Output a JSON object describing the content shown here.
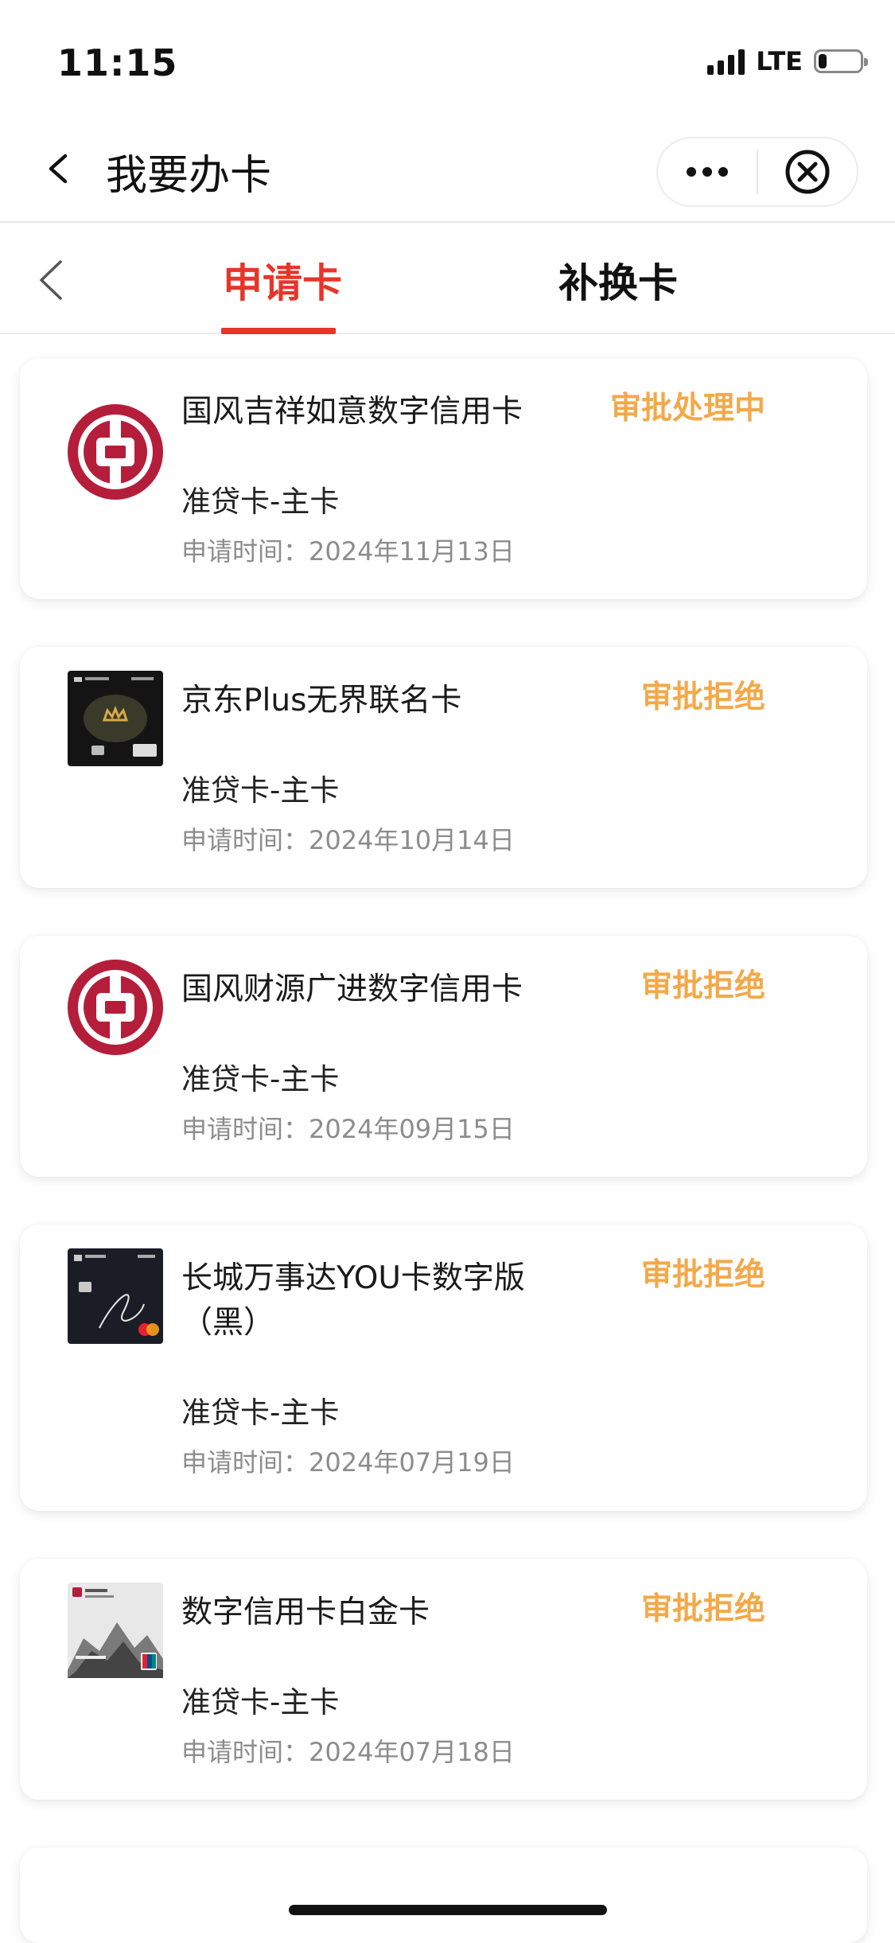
{
  "status_bar": {
    "time": "11:15",
    "network": "LTE",
    "battery_level": 0.2
  },
  "header": {
    "title": "我要办卡",
    "back_icon": "chevron-left-icon",
    "more_icon": "more-dots-icon",
    "close_icon": "close-circle-icon"
  },
  "tabs": {
    "items": [
      {
        "label": "申请卡",
        "active": true
      },
      {
        "label": "补换卡",
        "active": false
      }
    ],
    "accent_color": "#e6352a"
  },
  "applications": [
    {
      "card_name": "国风吉祥如意数字信用卡",
      "status": "审批处理中",
      "card_type": "准贷卡-主卡",
      "apply_time": "申请时间：2024年11月13日",
      "icon": "bank-of-china-logo"
    },
    {
      "card_name": "京东Plus无界联名卡",
      "status": "审批拒绝",
      "card_type": "准贷卡-主卡",
      "apply_time": "申请时间：2024年10月14日",
      "icon": "black-card-thumbnail"
    },
    {
      "card_name": "国风财源广进数字信用卡",
      "status": "审批拒绝",
      "card_type": "准贷卡-主卡",
      "apply_time": "申请时间：2024年09月15日",
      "icon": "bank-of-china-logo"
    },
    {
      "card_name": "长城万事达YOU卡数字版（黑）",
      "status": "审批拒绝",
      "card_type": "准贷卡-主卡",
      "apply_time": "申请时间：2024年07月19日",
      "icon": "mastercard-black-card-thumbnail"
    },
    {
      "card_name": "数字信用卡白金卡",
      "status": "审批拒绝",
      "card_type": "准贷卡-主卡",
      "apply_time": "申请时间：2024年07月18日",
      "icon": "platinum-card-thumbnail"
    }
  ],
  "colors": {
    "status_color": "#f2a94a",
    "bank_red": "#b41e3a"
  }
}
